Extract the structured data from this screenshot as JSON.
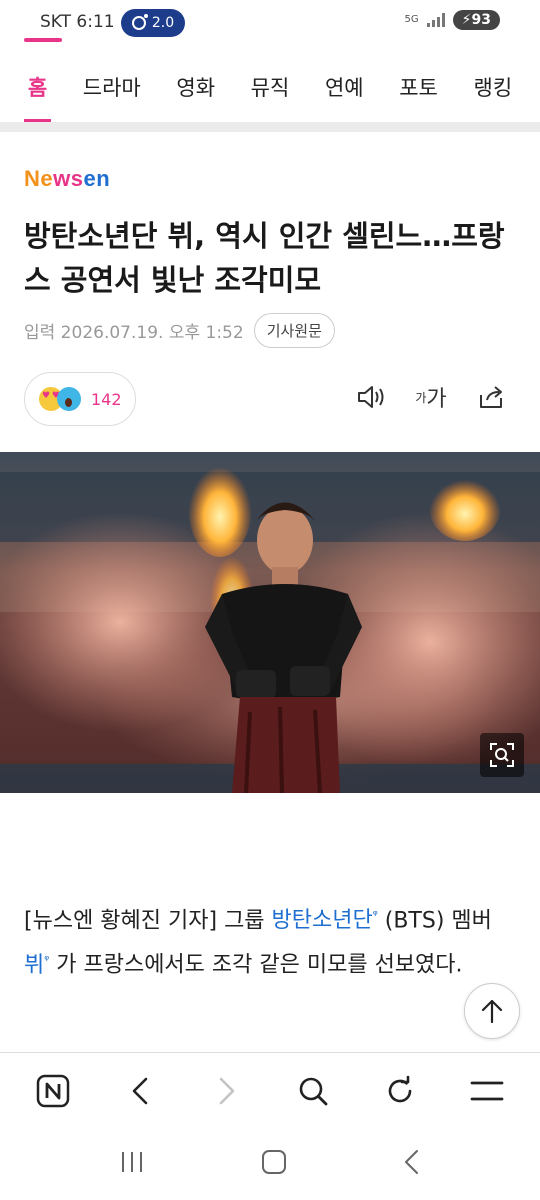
{
  "status_bar": {
    "carrier_time": "SKT 6:11",
    "pill_label": "2.0",
    "network": "5G",
    "battery": "93"
  },
  "tabs": [
    {
      "label": "홈",
      "active": true
    },
    {
      "label": "드라마",
      "active": false
    },
    {
      "label": "영화",
      "active": false
    },
    {
      "label": "뮤직",
      "active": false
    },
    {
      "label": "연예",
      "active": false
    },
    {
      "label": "포토",
      "active": false
    },
    {
      "label": "랭킹",
      "active": false
    }
  ],
  "article": {
    "logo_parts": [
      "Ne",
      "ws",
      "en"
    ],
    "headline": "방탄소년단 뷔, 역시 인간 셀린느…프랑스 공연서 빛난 조각미모",
    "date": "입력 2026.07.19. 오후 1:52",
    "source_button": "기사원문",
    "reaction_count": "142",
    "font_icon_small": "가",
    "font_icon_large": "가",
    "body": {
      "p1_a": "[뉴스엔 황혜진 기자] 그룹 ",
      "link1": "방탄소년단",
      "p1_b": " (BTS) 멤버 ",
      "link2": "뷔",
      "p1_c": " 가 프랑스에서도 조각 같은 미모를 선보였다."
    }
  },
  "colors": {
    "accent": "#e8358a",
    "link": "#1f6fd0",
    "logo_orange": "#f2911b",
    "pill": "#1d3d8c"
  },
  "icons": {
    "speaker": "speaker-icon",
    "font_size": "font-size-icon",
    "share": "share-icon",
    "zoom": "zoom-icon",
    "scroll_top": "arrow-up-icon"
  }
}
